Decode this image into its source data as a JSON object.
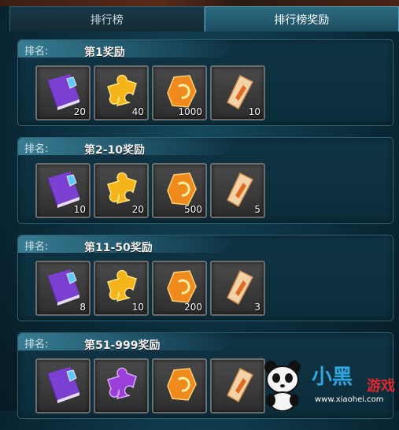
{
  "tabs": [
    {
      "label": "排行榜",
      "active": false
    },
    {
      "label": "排行榜奖励",
      "active": true
    }
  ],
  "rank_label": "排名:",
  "reward_tiers": [
    {
      "title": "第1奖励",
      "items": [
        {
          "icon": "purple-book-icon",
          "qty": "20"
        },
        {
          "icon": "gold-puzzle-icon",
          "qty": "40"
        },
        {
          "icon": "orange-ore-icon",
          "qty": "1000"
        },
        {
          "icon": "scroll-icon",
          "qty": "10"
        }
      ]
    },
    {
      "title": "第2-10奖励",
      "items": [
        {
          "icon": "purple-book-icon",
          "qty": "10"
        },
        {
          "icon": "gold-puzzle-icon",
          "qty": "20"
        },
        {
          "icon": "orange-ore-icon",
          "qty": "500"
        },
        {
          "icon": "scroll-icon",
          "qty": "5"
        }
      ]
    },
    {
      "title": "第11-50奖励",
      "items": [
        {
          "icon": "purple-book-icon",
          "qty": "8"
        },
        {
          "icon": "gold-puzzle-icon",
          "qty": "10"
        },
        {
          "icon": "orange-ore-icon",
          "qty": "200"
        },
        {
          "icon": "scroll-icon",
          "qty": "3"
        }
      ]
    },
    {
      "title": "第51-999奖励",
      "items": [
        {
          "icon": "purple-book-icon",
          "qty": ""
        },
        {
          "icon": "purple-puzzle-icon",
          "qty": ""
        },
        {
          "icon": "orange-ore-icon",
          "qty": ""
        },
        {
          "icon": "scroll-icon",
          "qty": ""
        }
      ]
    }
  ],
  "watermark": {
    "brand": "小黑",
    "suffix": "游戏",
    "url": "www.xiaohei.com"
  }
}
